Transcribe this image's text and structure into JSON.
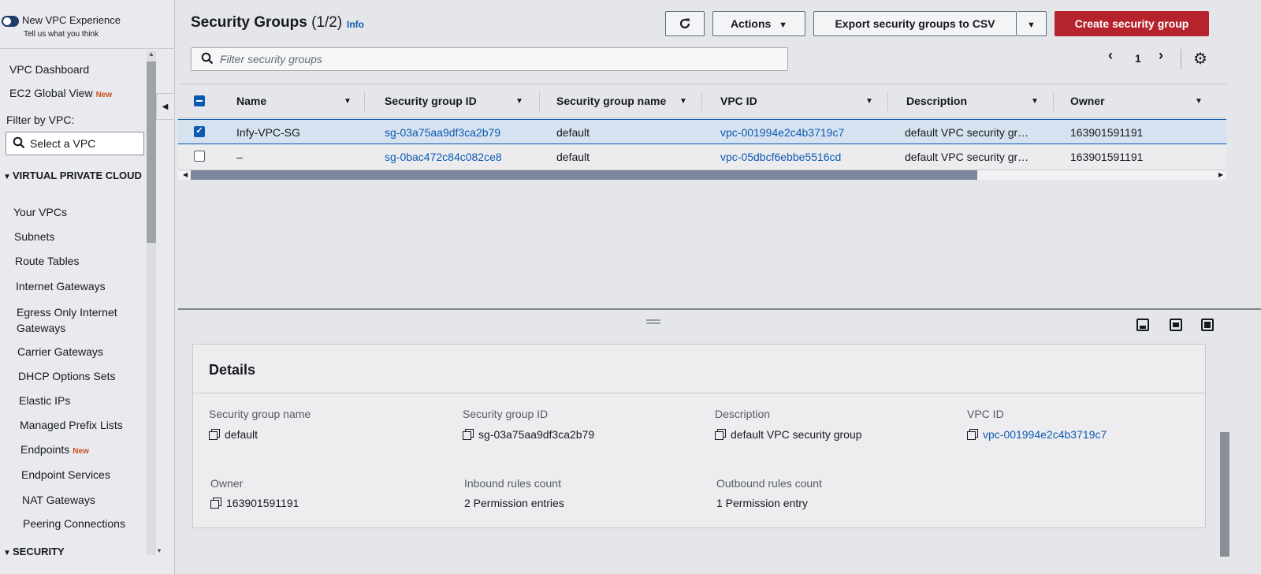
{
  "sidebar": {
    "toggle_label": "New VPC Experience",
    "toggle_sub": "Tell us what you think",
    "vpc_dashboard": "VPC Dashboard",
    "ec2_global_view": "EC2 Global View",
    "new_badge": "New",
    "filter_by_vpc": "Filter by VPC:",
    "select_vpc": "Select a VPC",
    "section_vpc": "VIRTUAL PRIVATE CLOUD",
    "items": [
      "Your VPCs",
      "Subnets",
      "Route Tables",
      "Internet Gateways",
      "Egress Only Internet Gateways",
      "Carrier Gateways",
      "DHCP Options Sets",
      "Elastic IPs",
      "Managed Prefix Lists",
      "Endpoints",
      "Endpoint Services",
      "NAT Gateways",
      "Peering Connections"
    ],
    "section_security": "SECURITY"
  },
  "header": {
    "title": "Security Groups",
    "count": "(1/2)",
    "info": "Info",
    "actions": "Actions",
    "export": "Export security groups to CSV",
    "create": "Create security group"
  },
  "filter": {
    "placeholder": "Filter security groups"
  },
  "pager": {
    "page": "1"
  },
  "table": {
    "columns": [
      "Name",
      "Security group ID",
      "Security group name",
      "VPC ID",
      "Description",
      "Owner"
    ],
    "rows": [
      {
        "selected": true,
        "name": "Infy-VPC-SG",
        "sg_id": "sg-03a75aa9df3ca2b79",
        "sg_name": "default",
        "vpc_id": "vpc-001994e2c4b3719c7",
        "description": "default VPC security gr…",
        "owner": "163901591191"
      },
      {
        "selected": false,
        "name": "–",
        "sg_id": "sg-0bac472c84c082ce8",
        "sg_name": "default",
        "vpc_id": "vpc-05dbcf6ebbe5516cd",
        "description": "default VPC security gr…",
        "owner": "163901591191"
      }
    ]
  },
  "details": {
    "title": "Details",
    "sg_name_label": "Security group name",
    "sg_name": "default",
    "sg_id_label": "Security group ID",
    "sg_id": "sg-03a75aa9df3ca2b79",
    "description_label": "Description",
    "description": "default VPC security group",
    "vpc_id_label": "VPC ID",
    "vpc_id": "vpc-001994e2c4b3719c7",
    "owner_label": "Owner",
    "owner": "163901591191",
    "inbound_label": "Inbound rules count",
    "inbound": "2 Permission entries",
    "outbound_label": "Outbound rules count",
    "outbound": "1 Permission entry"
  },
  "colors": {
    "accent": "#0b5ab1",
    "create_button": "#b5242c",
    "selected_row": "#d6e2ef"
  }
}
